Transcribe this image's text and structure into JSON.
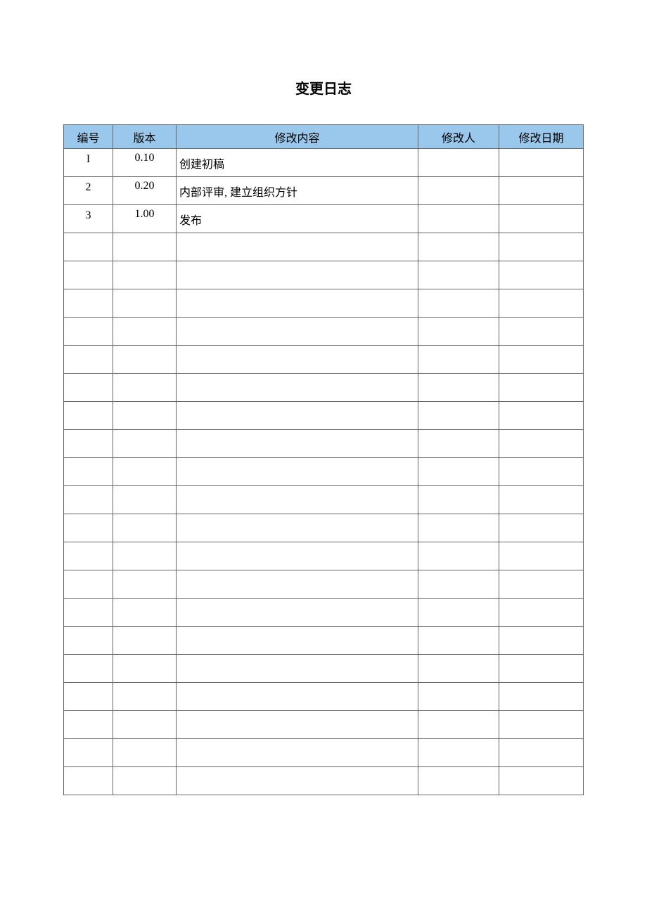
{
  "title": "变更日志",
  "headers": {
    "num": "编号",
    "ver": "版本",
    "content": "修改内容",
    "author": "修改人",
    "date": "修改日期"
  },
  "rows": [
    {
      "num": "I",
      "ver": "0.10",
      "content": "创建初稿",
      "author": "",
      "date": ""
    },
    {
      "num": "2",
      "ver": "0.20",
      "content": "内部评审, 建立组织方针",
      "author": "",
      "date": ""
    },
    {
      "num": "3",
      "ver": "1.00",
      "content": "发布",
      "author": "",
      "date": ""
    },
    {
      "num": "",
      "ver": "",
      "content": "",
      "author": "",
      "date": ""
    },
    {
      "num": "",
      "ver": "",
      "content": "",
      "author": "",
      "date": ""
    },
    {
      "num": "",
      "ver": "",
      "content": "",
      "author": "",
      "date": ""
    },
    {
      "num": "",
      "ver": "",
      "content": "",
      "author": "",
      "date": ""
    },
    {
      "num": "",
      "ver": "",
      "content": "",
      "author": "",
      "date": ""
    },
    {
      "num": "",
      "ver": "",
      "content": "",
      "author": "",
      "date": ""
    },
    {
      "num": "",
      "ver": "",
      "content": "",
      "author": "",
      "date": ""
    },
    {
      "num": "",
      "ver": "",
      "content": "",
      "author": "",
      "date": ""
    },
    {
      "num": "",
      "ver": "",
      "content": "",
      "author": "",
      "date": ""
    },
    {
      "num": "",
      "ver": "",
      "content": "",
      "author": "",
      "date": ""
    },
    {
      "num": "",
      "ver": "",
      "content": "",
      "author": "",
      "date": ""
    },
    {
      "num": "",
      "ver": "",
      "content": "",
      "author": "",
      "date": ""
    },
    {
      "num": "",
      "ver": "",
      "content": "",
      "author": "",
      "date": ""
    },
    {
      "num": "",
      "ver": "",
      "content": "",
      "author": "",
      "date": ""
    },
    {
      "num": "",
      "ver": "",
      "content": "",
      "author": "",
      "date": ""
    },
    {
      "num": "",
      "ver": "",
      "content": "",
      "author": "",
      "date": ""
    },
    {
      "num": "",
      "ver": "",
      "content": "",
      "author": "",
      "date": ""
    },
    {
      "num": "",
      "ver": "",
      "content": "",
      "author": "",
      "date": ""
    },
    {
      "num": "",
      "ver": "",
      "content": "",
      "author": "",
      "date": ""
    },
    {
      "num": "",
      "ver": "",
      "content": "",
      "author": "",
      "date": ""
    }
  ]
}
